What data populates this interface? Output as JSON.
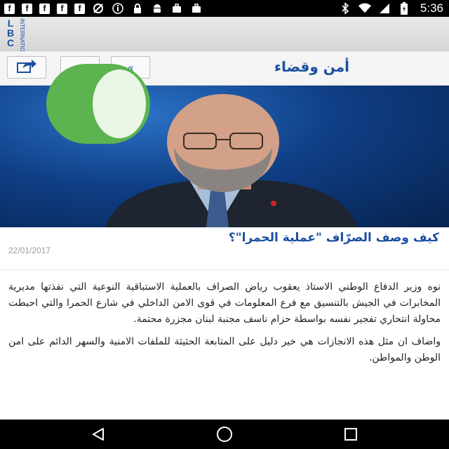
{
  "status_bar": {
    "time": "5:36",
    "left_icons": [
      "facebook-icon",
      "facebook-icon",
      "facebook-icon",
      "facebook-icon",
      "facebook-icon",
      "no-location-icon",
      "info-icon",
      "lock-icon",
      "android-icon",
      "briefcase-icon",
      "briefcase-icon"
    ],
    "right_icons": [
      "bluetooth-icon",
      "wifi-icon",
      "signal-icon",
      "battery-icon"
    ]
  },
  "app_bar": {
    "logo_text": "LBC",
    "logo_subtext": "INTERNATIONAL"
  },
  "section_header": {
    "title": "أمن وقضاء",
    "share_icon": "share-icon",
    "partial_button_glyph": "«"
  },
  "article": {
    "title": "كيف وصف الصرّاف \"عملية الحمرا\"؟",
    "date": "22/01/2017",
    "paragraphs": [
      "نوه وزير الدفاع الوطني الاستاذ يعقوب رياض الصراف بالعملية الاستباقية النوعية التي نفذتها مديرية المخابرات في الجيش بالتنسيق مع فرع المعلومات في قوى الامن الداخلي في شارع الحمرا والتي احبطت محاولة انتحاري تفجير نفسه بواسطة حزام ناسف مجنبة لبنان مجزرة محتمة.",
      "واضاف ان مثل هذه الانجازات هي خير دليل على المتابعة الحثيثة للملفات الامنية والسهر الدائم على امن الوطن والمواطن."
    ]
  },
  "overlay": {
    "type": "green-toggle"
  },
  "nav_bar": {
    "back_icon": "back-icon",
    "home_icon": "home-icon",
    "recents_icon": "recents-icon"
  },
  "colors": {
    "accent_blue": "#1b4fa0",
    "overlay_green": "#5cb350"
  }
}
